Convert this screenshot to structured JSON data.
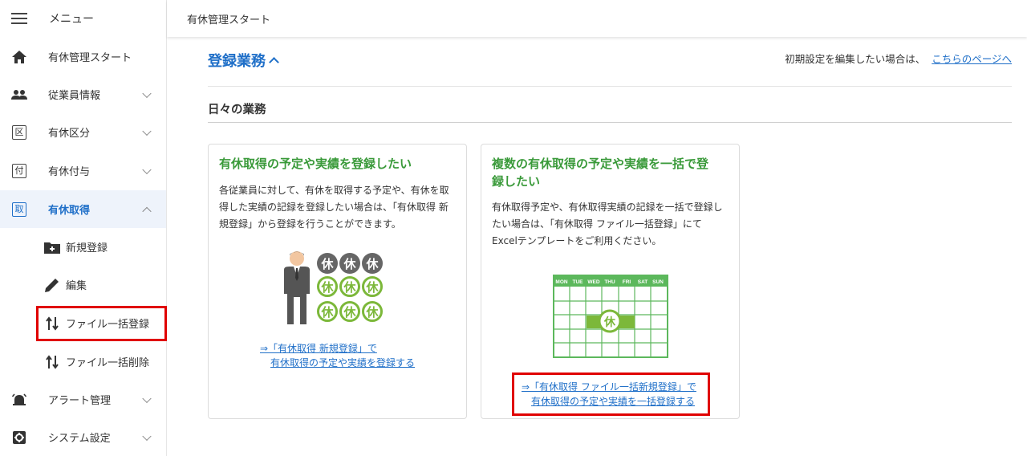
{
  "sidebar": {
    "menu_title": "メニュー",
    "items": [
      {
        "label": "有休管理スタート"
      },
      {
        "label": "従業員情報"
      },
      {
        "label": "有休区分",
        "icon_glyph": "区"
      },
      {
        "label": "有休付与",
        "icon_glyph": "付"
      },
      {
        "label": "有休取得",
        "icon_glyph": "取"
      },
      {
        "label": "アラート管理"
      },
      {
        "label": "システム設定"
      }
    ],
    "sub_items": [
      {
        "label": "新規登録"
      },
      {
        "label": "編集"
      },
      {
        "label": "ファイル一括登録"
      },
      {
        "label": "ファイル一括削除"
      }
    ]
  },
  "topbar": {
    "breadcrumb": "有休管理スタート"
  },
  "main": {
    "section_title": "登録業務",
    "init_text": "初期設定を編集したい場合は、",
    "init_link": "こちらのページへ",
    "subsection_title": "日々の業務",
    "cards": [
      {
        "title": "有休取得の予定や実績を登録したい",
        "text_lines": [
          "各従業員に対して、有休を取得する予定や、有休を取",
          "得した実績の記録を登録したい場合は、「有休取得 新",
          "規登録」から登録を行うことができます。"
        ],
        "link_line1": "⇒「有休取得 新規登録」で",
        "link_line2": "有休取得の予定や実績を登録する",
        "badge_char": "休"
      },
      {
        "title_line1": "複数の有休取得の予定や実績を一括で登",
        "title_line2": "録したい",
        "text_lines": [
          "有休取得予定や、有休取得実績の記録を一括で登録し",
          "たい場合は、「有休取得 ファイル一括登録」にて",
          "Excelテンプレートをご利用ください。"
        ],
        "link_line1": "⇒「有休取得 ファイル一括新規登録」で",
        "link_line2": "有休取得の予定や実績を一括登録する",
        "calendar_days": [
          "MON",
          "TUE",
          "WED",
          "THU",
          "FRI",
          "SAT",
          "SUN"
        ],
        "badge_char": "休"
      }
    ]
  },
  "colors": {
    "accent": "#1f6fc8",
    "green": "#3a9a3a",
    "highlight": "#e00000",
    "active_bg": "#eef3fb"
  }
}
